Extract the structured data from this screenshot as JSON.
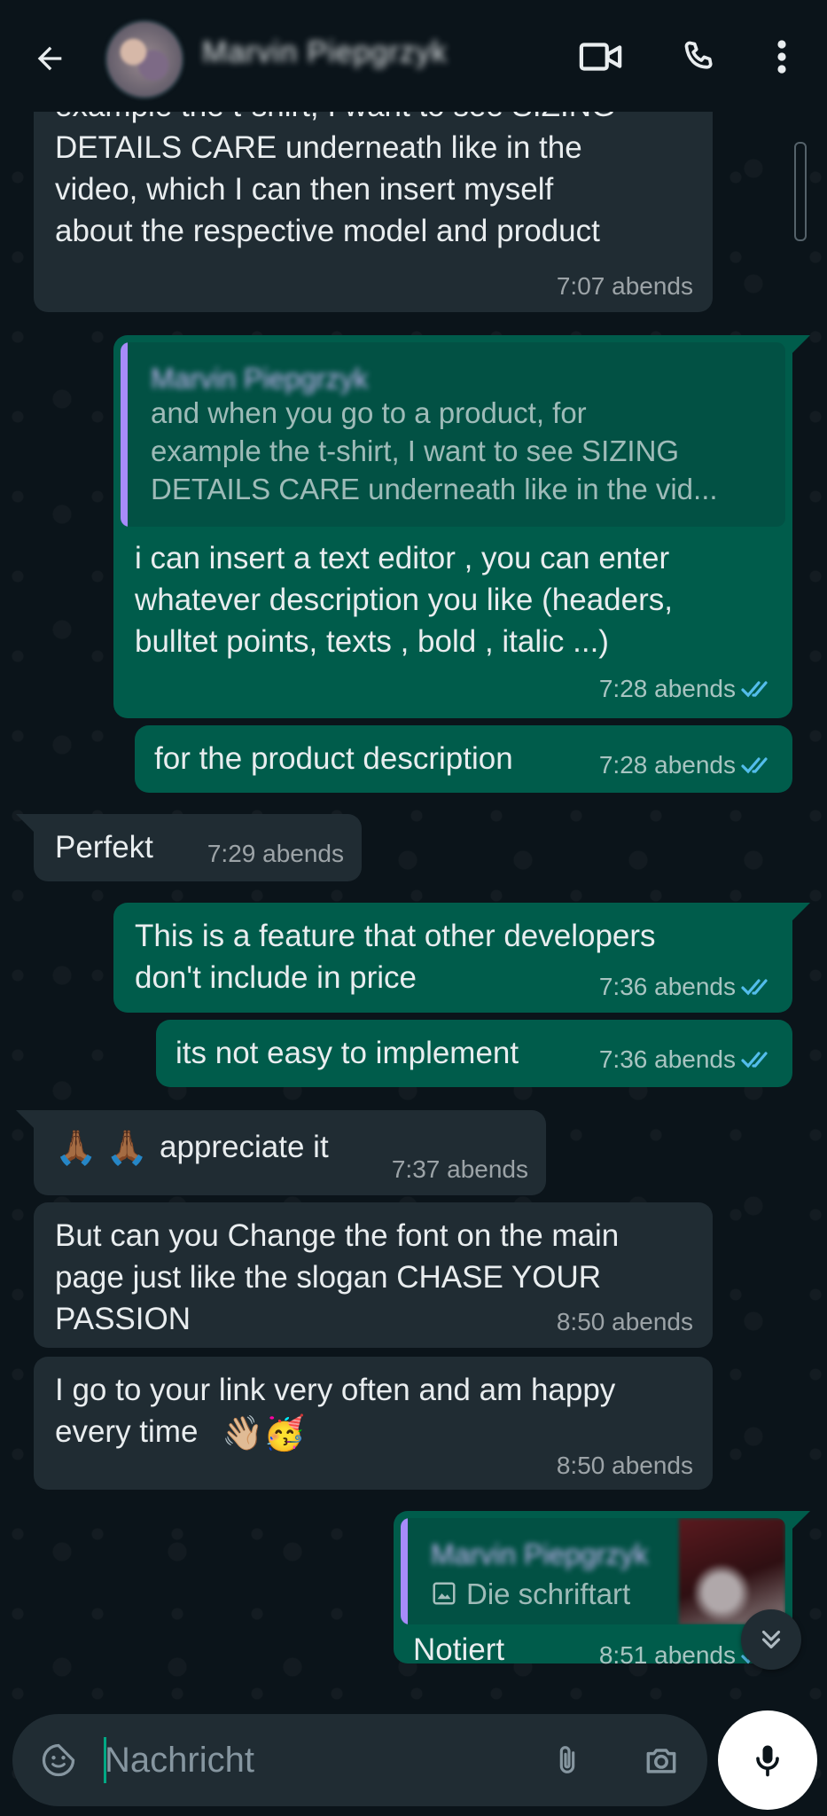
{
  "header": {
    "contact_name": "Marvin Piepgrzyk"
  },
  "messages": [
    {
      "dir": "in",
      "text": "example the t-shirt, I want to see SIZING\nDETAILS CARE underneath like in the\nvideo, which I can then insert myself\nabout the respective model and product",
      "time": "7:07 abends"
    },
    {
      "dir": "out",
      "quote_name": "Marvin Piepgrzyk",
      "quote_text": "and when you go to a product, for\nexample the t-shirt, I want to see SIZING\nDETAILS CARE underneath like in the vid...",
      "text": "i can insert a text editor , you can enter\nwhatever description you like (headers,\nbulltet points, texts , bold , italic ...)",
      "time": "7:28 abends"
    },
    {
      "dir": "out",
      "text": "for the product description",
      "time": "7:28 abends"
    },
    {
      "dir": "in",
      "text": "Perfekt",
      "time": "7:29 abends"
    },
    {
      "dir": "out",
      "text": "This is a feature that other developers\ndon't include in price",
      "time": "7:36 abends"
    },
    {
      "dir": "out",
      "text": "its not easy to implement",
      "time": "7:36 abends"
    },
    {
      "dir": "in",
      "emoji": "🙏🏾 🙏🏾",
      "text": "appreciate it",
      "time": "7:37 abends"
    },
    {
      "dir": "in",
      "text": "But can you Change the font on the main\npage just like the slogan CHASE YOUR\nPASSION",
      "time": "8:50 abends"
    },
    {
      "dir": "in",
      "text": "I go to your link very often and am happy\nevery time",
      "emoji": "👋🏼🥳",
      "time": "8:50 abends"
    },
    {
      "dir": "out",
      "quote_name": "Marvin Piepgrzyk",
      "quote_text": "Die schriftart",
      "text": "Notiert",
      "time": "8:51 abends"
    }
  ],
  "composer": {
    "placeholder": "Nachricht"
  },
  "colors": {
    "incoming": "#202c33",
    "outgoing": "#005c4b",
    "read_ticks": "#53bdeb",
    "accent": "#00a884"
  }
}
